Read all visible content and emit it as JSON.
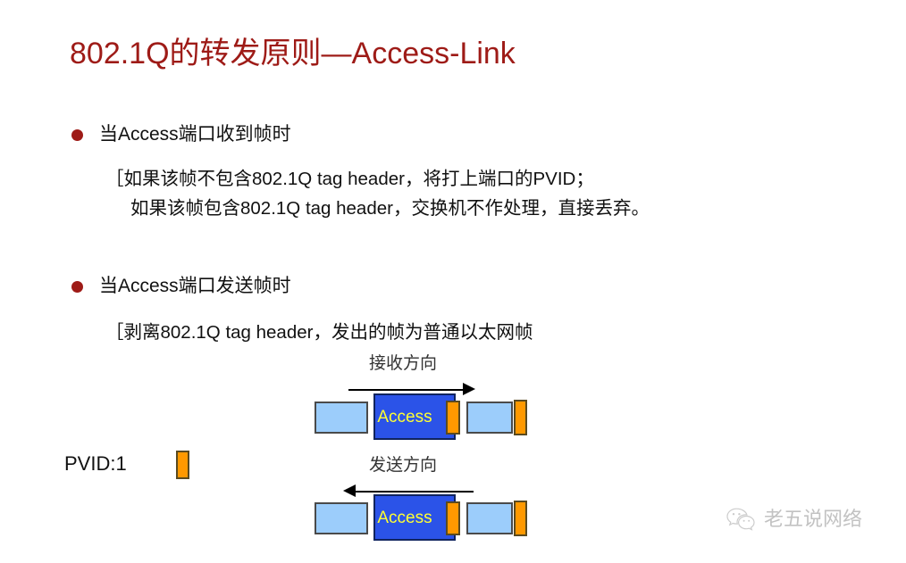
{
  "slide": {
    "title": "802.1Q的转发原则—Access-Link",
    "title_color": "#9E1B17"
  },
  "bullets": [
    {
      "marker": "dot",
      "text": "当Access端口收到帧时",
      "sub_lines": [
        "［如果该帧不包含802.1Q  tag header，将打上端口的PVID；",
        "如果该帧包含802.1Q tag header，交换机不作处理，直接丢弃。"
      ]
    },
    {
      "marker": "dot",
      "text": "当Access端口发送帧时",
      "sub_lines": [
        "［剥离802.1Q  tag header，发出的帧为普通以太网帧"
      ]
    }
  ],
  "diagram": {
    "receive": {
      "direction_label": "接收方向",
      "arrow": "arrow-right",
      "port_label": "Access"
    },
    "send": {
      "direction_label": "发送方向",
      "arrow": "arrow-left",
      "port_label": "Access"
    },
    "legend": {
      "pvid_label": "PVID:1",
      "tag_swatch_color": "#FF9900"
    },
    "colors": {
      "frame_box": "#9CCDFB",
      "access_box": "#2B53E8",
      "access_text": "#FFFF33",
      "tag": "#FF9900"
    }
  },
  "watermark": {
    "text": "老五说网络",
    "icon": "wechat-icon"
  }
}
